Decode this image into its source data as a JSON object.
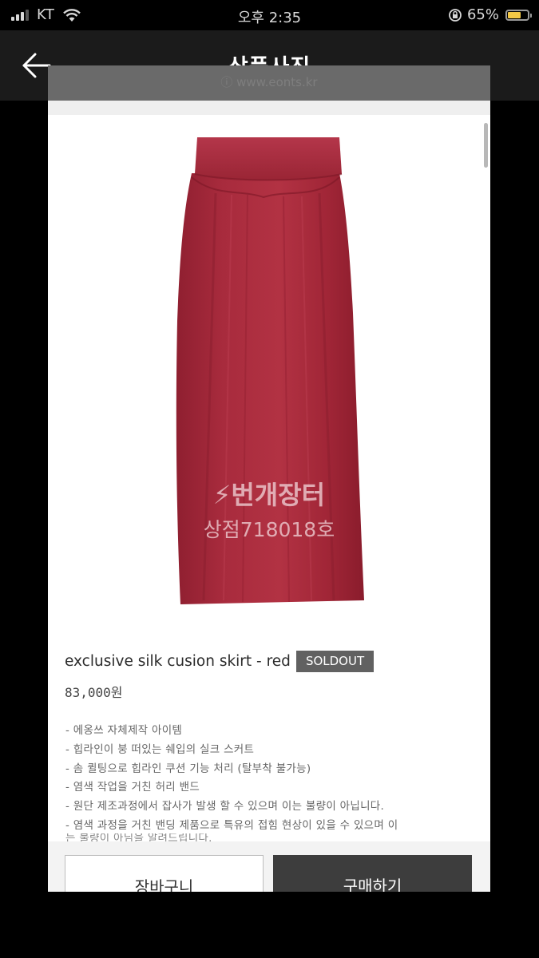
{
  "status_bar": {
    "carrier": "KT",
    "time": "오후 2:35",
    "battery": "65%"
  },
  "header": {
    "title": "상품사진",
    "back_icon": "arrow-left-icon"
  },
  "screenshot": {
    "url": "ⓘ www.eonts.kr",
    "watermark": {
      "brand": "번개장터",
      "store": "상점718018호"
    },
    "product": {
      "name": "exclusive silk cusion skirt - red",
      "badge": "SOLDOUT",
      "price": "83,000원",
      "color": "#a52a3b",
      "description": [
        "- 에옹쓰 자체제작 아이템",
        "- 힙라인이 붕 떠있는 쉐입의 실크 스커트",
        "- 솜 퀼팅으로 힙라인 쿠션 기능 처리 (탈부착 불가능)",
        "- 염색 작업을 거친 허리 밴드",
        "- 원단 제조과정에서 잡사가 발생 할 수 있으며 이는 불량이 아닙니다.",
        "- 염색 과정을 거친 밴딩 제품으로 특유의 접힘 현상이 있을 수 있으며 이",
        "는 불량이 아님을 알려드립니다."
      ]
    },
    "buttons": {
      "cart": "장바구니",
      "buy": "구매하기"
    }
  }
}
